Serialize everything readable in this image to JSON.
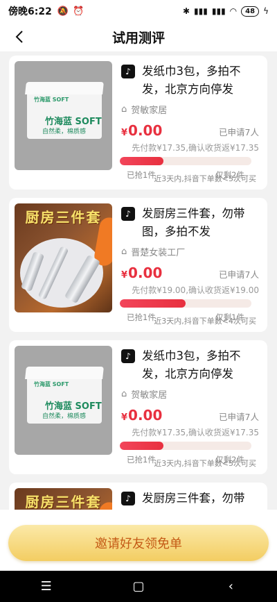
{
  "status_bar": {
    "time": "傍晚6:22",
    "battery": "48"
  },
  "header": {
    "title": "试用测评"
  },
  "items": [
    {
      "thumb": "tissue",
      "name": "发纸巾3包，多拍不发，北京方向停发",
      "shop": "贺敏家居",
      "price_symbol": "¥",
      "price": "0.00",
      "applied": "已申请7人",
      "pay": "先付款¥17.35,确认收货返¥17.35",
      "progress": 0.33,
      "grabbed": "已抢1件",
      "remaining": "仅剩2件",
      "limit": "近3天内,抖音下单数<5次可买",
      "img_logo": "竹海蓝 SOFT",
      "img_sub": "自然柔，棉质感"
    },
    {
      "thumb": "kitchen",
      "name": "发厨房三件套，勿带图，多拍不发",
      "shop": "晋楚女装工厂",
      "price_symbol": "¥",
      "price": "0.00",
      "applied": "已申请7人",
      "pay": "先付款¥19.00,确认收货返¥19.00",
      "progress": 0.5,
      "grabbed": "已抢1件",
      "remaining": "仅剩1件",
      "limit": "近3天内,抖音下单数<4次可买",
      "img_text": "厨房三件套"
    },
    {
      "thumb": "tissue",
      "name": "发纸巾3包，多拍不发，北京方向停发",
      "shop": "贺敏家居",
      "price_symbol": "¥",
      "price": "0.00",
      "applied": "已申请7人",
      "pay": "先付款¥17.35,确认收货返¥17.35",
      "progress": 0.33,
      "grabbed": "已抢1件",
      "remaining": "仅剩2件",
      "limit": "近3天内,抖音下单数<5次可买",
      "img_logo": "竹海蓝 SOFT",
      "img_sub": "自然柔，棉质感"
    },
    {
      "thumb": "kitchen",
      "name": "发厨房三件套，勿带图，多拍不发",
      "img_text": "厨房三件套"
    }
  ],
  "cta": {
    "label": "邀请好友领免单"
  }
}
